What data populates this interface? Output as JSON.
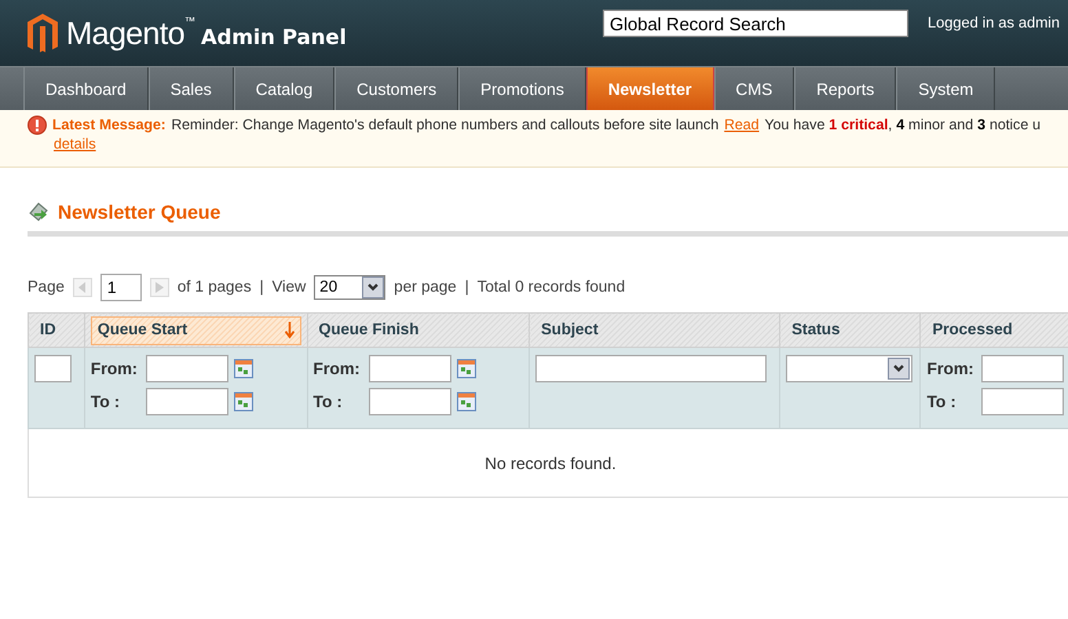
{
  "header": {
    "logo": "Magento",
    "logo_mark": "™",
    "logo_suffix": "Admin Panel",
    "search": {
      "value": "Global Record Search"
    },
    "user": "Logged in as admin"
  },
  "nav": [
    {
      "label": "Dashboard",
      "selected": false
    },
    {
      "label": "Sales",
      "selected": false
    },
    {
      "label": "Catalog",
      "selected": false
    },
    {
      "label": "Customers",
      "selected": false
    },
    {
      "label": "Promotions",
      "selected": false
    },
    {
      "label": "Newsletter",
      "selected": true
    },
    {
      "label": "CMS",
      "selected": false
    },
    {
      "label": "Reports",
      "selected": false
    },
    {
      "label": "System",
      "selected": false
    }
  ],
  "notice": {
    "label": "Latest Message:",
    "message": "Reminder: Change Magento's default phone numbers and callouts before site launch",
    "read_link": "Read",
    "summary": "You have **1 critical**, **4** minor and **3** notice u",
    "details_link": "details"
  },
  "page_title": "Newsletter Queue",
  "pager": {
    "page_label": "Page",
    "page": "1",
    "of_pages": "of 1 pages",
    "separator": "|",
    "view_label": "View",
    "per_page": "20",
    "per_page_label": "per page",
    "total": "Total 0 records found"
  },
  "grid": {
    "columns": [
      {
        "label": "ID",
        "kind": "text",
        "sorted": false
      },
      {
        "label": "Queue Start",
        "kind": "daterange",
        "sorted": true,
        "from_label": "From:",
        "to_label": "To :"
      },
      {
        "label": "Queue Finish",
        "kind": "daterange",
        "sorted": false,
        "from_label": "From:",
        "to_label": "To :"
      },
      {
        "label": "Subject",
        "kind": "text",
        "sorted": false
      },
      {
        "label": "Status",
        "kind": "select",
        "sorted": false
      },
      {
        "label": "Processed",
        "kind": "range",
        "sorted": false,
        "from_label": "From:",
        "to_label": "To :"
      }
    ],
    "empty": "No records found."
  }
}
